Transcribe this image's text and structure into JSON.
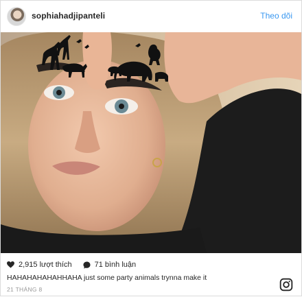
{
  "post": {
    "username": "sophiahadjipanteli",
    "follow_label": "Theo dõi",
    "likes_text": "2,915 lượt thích",
    "comments_text": "71 bình luận",
    "caption": "HAHAHAHAHAHHAHA just some party animals trynna make it",
    "date": "21 THÁNG 8"
  },
  "icons": {
    "like": "heart-icon",
    "comment": "comment-icon",
    "brand": "instagram-icon"
  },
  "colors": {
    "link_blue": "#3897f0",
    "text": "#262626",
    "muted": "#999999",
    "border": "#dbdbdb"
  }
}
